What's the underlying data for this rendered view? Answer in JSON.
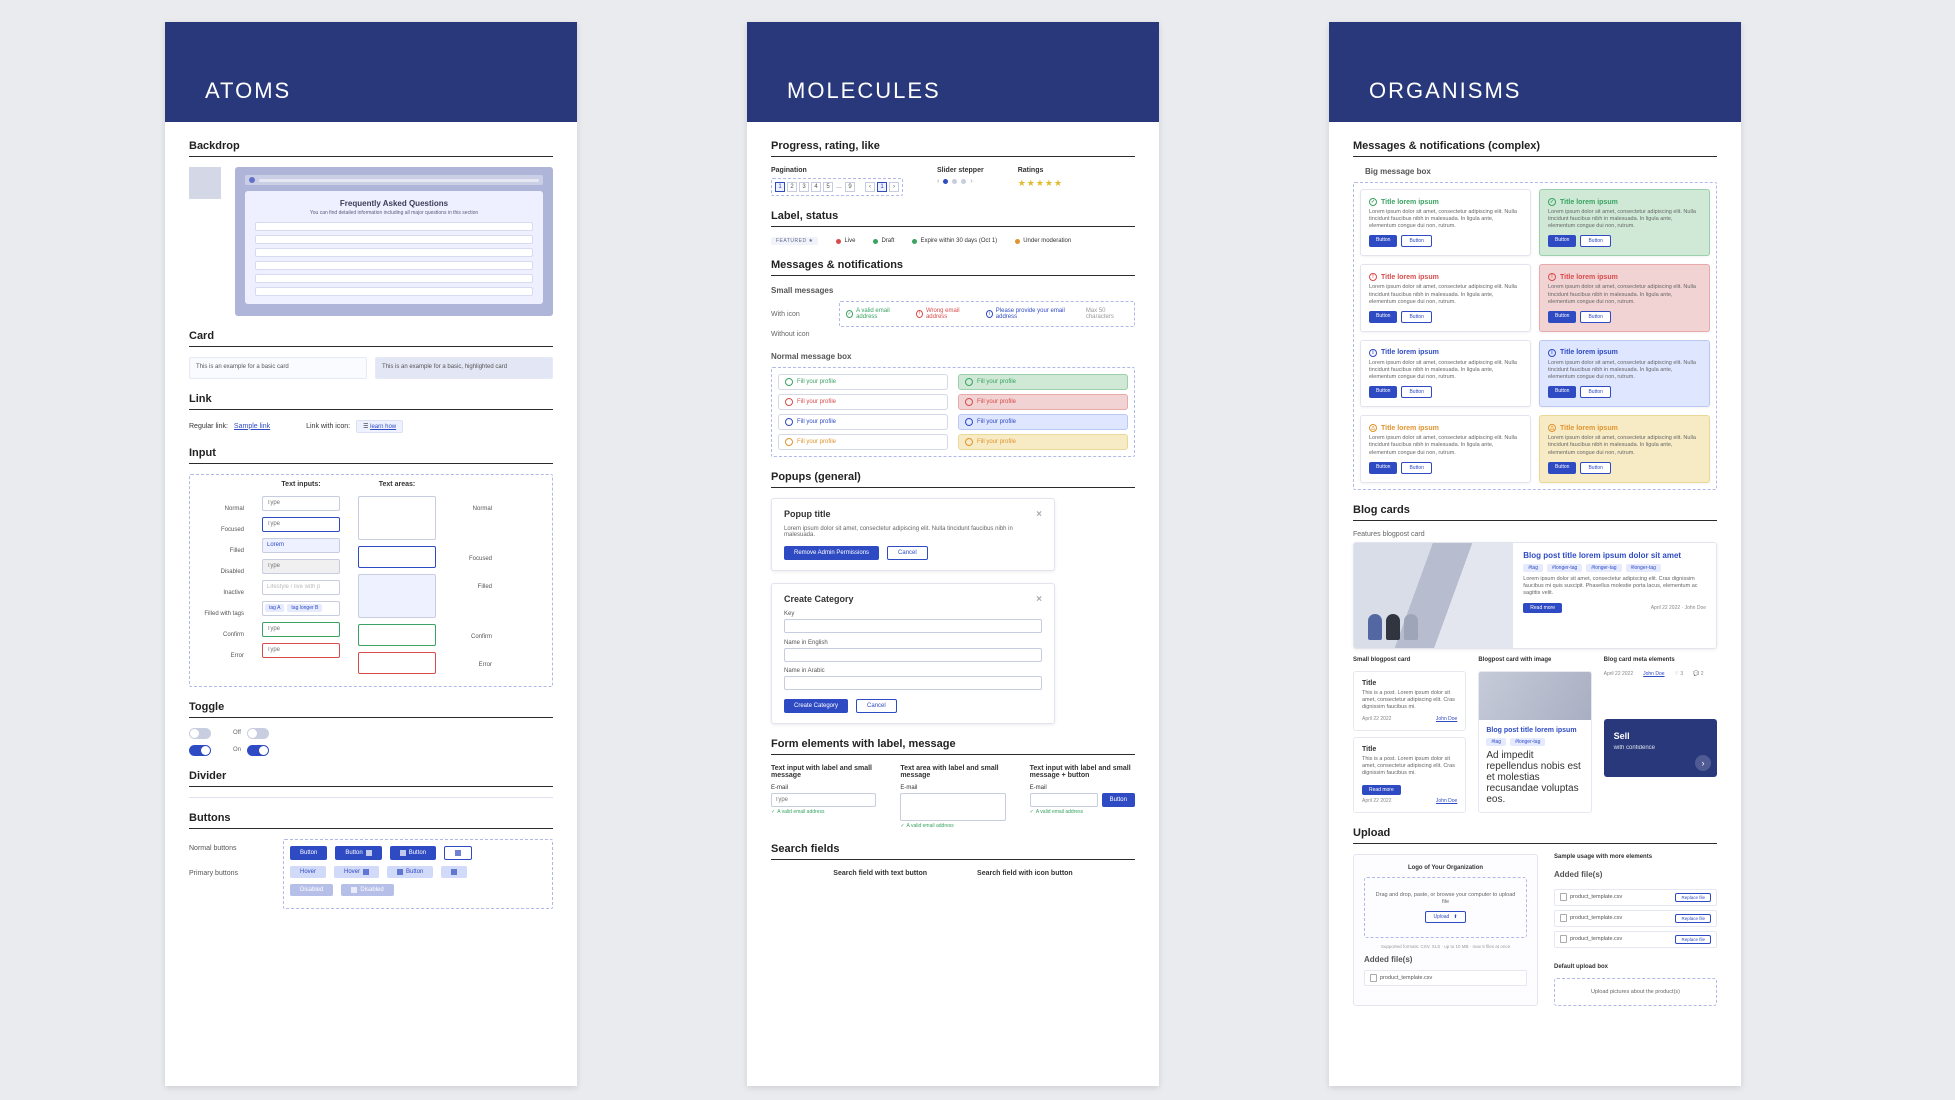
{
  "atoms": {
    "title": "ATOMS",
    "backdrop": {
      "heading": "Backdrop",
      "faq_title": "Frequently Asked Questions",
      "faq_sub": "You can find detailed information including all major questions in this section"
    },
    "card": {
      "heading": "Card",
      "example_a": "This is an example for a basic card",
      "example_b": "This is an example for a basic, highlighted card"
    },
    "link": {
      "heading": "Link",
      "regular_label": "Regular link:",
      "regular_value": "Sample link",
      "with_icon_label": "Link with icon:",
      "with_icon_value": "learn how"
    },
    "input": {
      "heading": "Input",
      "col_inputs": "Text inputs:",
      "col_areas": "Text areas:",
      "rows": [
        "Normal",
        "Focused",
        "Filled",
        "Disabled",
        "Inactive",
        "Filled with tags",
        "Confirm",
        "Error"
      ],
      "placeholder": "Type",
      "filled": "Lorem",
      "inactive": "Lifestyle / live with p",
      "tag_a": "tag A",
      "tag_b": "tag longer B",
      "area_labels": [
        "Normal",
        "Focused",
        "Filled",
        "Confirm",
        "Error"
      ]
    },
    "toggle": {
      "heading": "Toggle",
      "off": "Off",
      "on": "On"
    },
    "divider": {
      "heading": "Divider"
    },
    "buttons": {
      "heading": "Buttons",
      "row1_label": "Normal buttons",
      "row2_label": "Primary buttons",
      "labels": [
        "Button",
        "Button",
        "Button",
        "Hover",
        "Button",
        "Disabled"
      ]
    }
  },
  "molecules": {
    "title": "MOLECULES",
    "prl": {
      "heading": "Progress, rating, like",
      "pagination": "Pagination",
      "stepper": "Slider stepper",
      "ratings": "Ratings",
      "pages": [
        "1",
        "2",
        "3",
        "4",
        "5",
        "…",
        "9"
      ]
    },
    "label_status": {
      "heading": "Label, status",
      "featured": "FEATURED ★",
      "items": [
        {
          "name": "Live",
          "color": "#d94b4b"
        },
        {
          "name": "Draft",
          "color": "#3aa361"
        },
        {
          "name": "Expire within 30 days (Oct 1)",
          "color": "#3aa361"
        },
        {
          "name": "Under moderation",
          "color": "#e0942e"
        }
      ]
    },
    "messages": {
      "heading": "Messages & notifications",
      "small_heading": "Small messages",
      "with_icon": "With icon",
      "without_icon": "Without icon",
      "items": [
        "A valid email address",
        "Wrong email address",
        "Please provide your email address",
        "Max 50 characters"
      ]
    },
    "normal_box": {
      "heading": "Normal message box",
      "text": "Fill your profile"
    },
    "popups": {
      "heading": "Popups (general)",
      "p1": {
        "title": "Popup title",
        "body": "Lorem ipsum dolor sit amet, consectetur adipiscing elit. Nulla tincidunt faucibus nibh in malesuada.",
        "primary": "Remove Admin Permissions",
        "secondary": "Cancel"
      },
      "p2": {
        "title": "Create Category",
        "key": "Key",
        "name_en": "Name in English",
        "name_ar": "Name in Arabic",
        "primary": "Create Category",
        "secondary": "Cancel"
      }
    },
    "form": {
      "heading": "Form elements with label, message",
      "col1": "Text input with label and small message",
      "col2": "Text area with label and small message",
      "col3": "Text input with label and small message + button",
      "label": "E-mail",
      "placeholder": "Type",
      "help": "A valid email address",
      "button": "Button"
    },
    "search": {
      "heading": "Search fields",
      "col1": "Search field with text button",
      "col2": "Search field with icon button"
    }
  },
  "organisms": {
    "title": "ORGANISMS",
    "bigmsg": {
      "heading": "Messages & notifications (complex)",
      "sub": "Big message box",
      "title": "Title lorem ipsum",
      "body": "Lorem ipsum dolor sit amet, consectetur adipiscing elit. Nulla tincidunt faucibus nibh in malesuada. In ligula ante, elementum congue dui non, rutrum.",
      "btn": "Button"
    },
    "blog": {
      "heading": "Blog cards",
      "feature_label": "Features blogpost card",
      "title": "Blog post title lorem ipsum dolor sit amet",
      "tags": [
        "#tag",
        "#longer-tag",
        "#longer-tag",
        "#longer-tag"
      ],
      "desc": "Lorem ipsum dolor sit amet, consectetur adipiscing elit. Cras dignissim faucibus mi quis suscipit. Phasellus molestie porta lacus, elementum ac sagittis velit.",
      "date": "April 22 2022 · John Doe",
      "read_more": "Read more",
      "col1_label": "Small blogpost card",
      "col2_label": "Blogpost card with image",
      "col3_label": "Blog card meta elements",
      "small_title": "Title",
      "small_desc": "This is a post. Lorem ipsum dolor sit amet, consectetur adipiscing elit. Cras dignissim faucibus mi.",
      "img_title": "Blog post title lorem ipsum",
      "img_tags": [
        "#tag",
        "#longer-tag"
      ],
      "img_desc": "Ad impedit repellendus nobis est et molestias recusandae voluptas eos.",
      "meta_date": "April 22 2022",
      "meta_author": "John Doe",
      "meta_likes": "♡ 3",
      "meta_comments": "💬 2",
      "sell_title": "Sell",
      "sell_sub": "with confidence"
    },
    "upload": {
      "heading": "Upload",
      "logo_label": "Logo of Your Organization",
      "dz_text": "Drag and drop, paste, or browse your computer to upload file",
      "upload_btn": "Upload",
      "dz_help": "Supported formats: CSV, XLS · up to 10 MB · max 5 files at once",
      "added_label": "Added file(s)",
      "sample_label": "Sample usage with more elements",
      "files": [
        "product_template.csv",
        "product_template.csv",
        "product_template.csv"
      ],
      "replace": "Replace file",
      "default_label": "Default upload box",
      "default_text": "Upload pictures about the product(s)"
    }
  }
}
